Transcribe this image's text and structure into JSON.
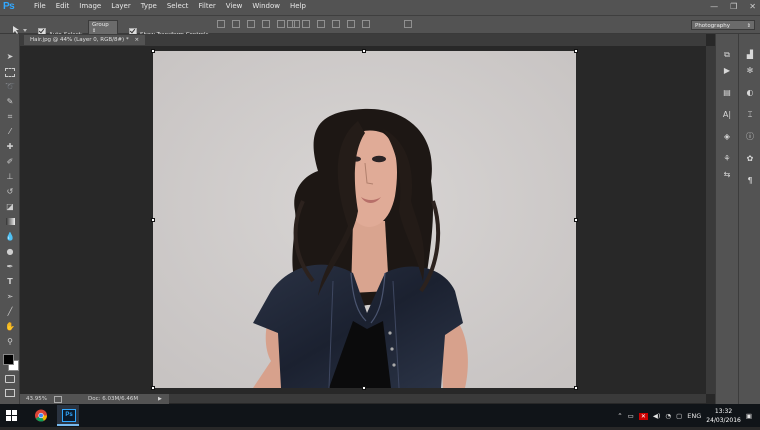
{
  "app": {
    "logo": "Ps"
  },
  "menu": [
    "File",
    "Edit",
    "Image",
    "Layer",
    "Type",
    "Select",
    "Filter",
    "View",
    "Window",
    "Help"
  ],
  "window_controls": {
    "minimize": "—",
    "restore": "❐",
    "close": "✕"
  },
  "options": {
    "auto_select_label": "Auto-Select:",
    "auto_select_value": "Group",
    "show_transform_label": "Show Transform Controls",
    "workspace": "Photography"
  },
  "document": {
    "tab_title": "Hair.jpg @ 44% (Layer 0, RGB/8#) *",
    "tab_close": "×"
  },
  "status": {
    "zoom": "43.95%",
    "doc_info": "Doc: 6.03M/6.46M"
  },
  "taskbar": {
    "language": "ENG",
    "time": "13:32",
    "date": "24/03/2016"
  },
  "colors": {
    "accent": "#31a8ff",
    "chrome": "#535353",
    "pasteboard": "#282828",
    "backdrop": "#d0cccb"
  }
}
